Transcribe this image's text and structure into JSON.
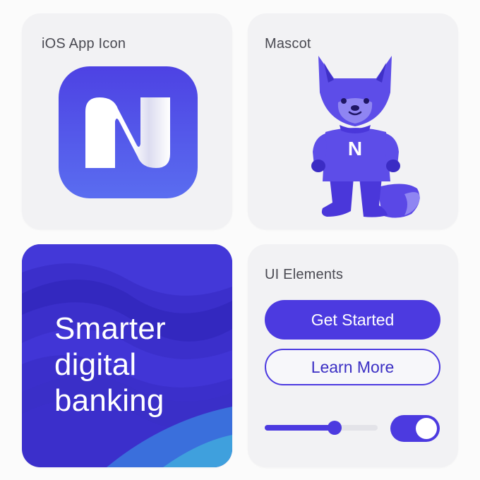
{
  "cards": {
    "app_icon": {
      "title": "iOS App Icon"
    },
    "mascot": {
      "title": "Mascot",
      "shirt_letter": "N"
    },
    "hero": {
      "headline": "Smarter\ndigital\nbanking"
    },
    "ui_elements": {
      "title": "UI Elements",
      "primary_button_label": "Get Started",
      "secondary_button_label": "Learn More",
      "slider_value": 0.62,
      "toggle_on": true
    }
  },
  "colors": {
    "brand_primary": "#4c3ae0",
    "brand_light": "#5b4ef0",
    "hero_dark": "#3a2ec8",
    "hero_accent": "#3fa0dd",
    "card_bg": "#f2f2f4"
  },
  "icons": {
    "app_icon": "n-logo-icon",
    "mascot": "fox-mascot-icon"
  }
}
